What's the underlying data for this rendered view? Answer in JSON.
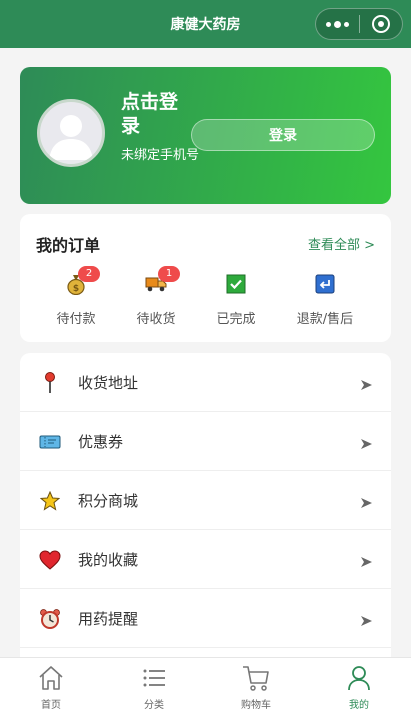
{
  "header": {
    "title": "康健大药房"
  },
  "login": {
    "title": "点击登录",
    "subtitle": "未绑定手机号",
    "button_label": "登录"
  },
  "orders": {
    "title": "我的订单",
    "view_all": "查看全部 >",
    "items": [
      {
        "label": "待付款",
        "icon": "money-bag-icon",
        "badge": "2"
      },
      {
        "label": "待收货",
        "icon": "delivery-truck-icon",
        "badge": "1"
      },
      {
        "label": "已完成",
        "icon": "check-box-icon",
        "badge": ""
      },
      {
        "label": "退款/售后",
        "icon": "return-icon",
        "badge": ""
      }
    ]
  },
  "menu": {
    "items": [
      {
        "label": "收货地址",
        "icon": "pushpin-icon"
      },
      {
        "label": "优惠券",
        "icon": "ticket-icon"
      },
      {
        "label": "积分商城",
        "icon": "star-icon"
      },
      {
        "label": "我的收藏",
        "icon": "heart-icon"
      },
      {
        "label": "用药提醒",
        "icon": "alarm-clock-icon"
      }
    ]
  },
  "tabbar": {
    "items": [
      {
        "label": "首页",
        "icon": "home-icon",
        "active": false
      },
      {
        "label": "分类",
        "icon": "list-icon",
        "active": false
      },
      {
        "label": "购物车",
        "icon": "cart-icon",
        "active": false
      },
      {
        "label": "我的",
        "icon": "user-icon",
        "active": true
      }
    ]
  },
  "colors": {
    "brand": "#2e8b57",
    "gradient_end": "#34c63f",
    "badge": "#ef4b4b"
  }
}
